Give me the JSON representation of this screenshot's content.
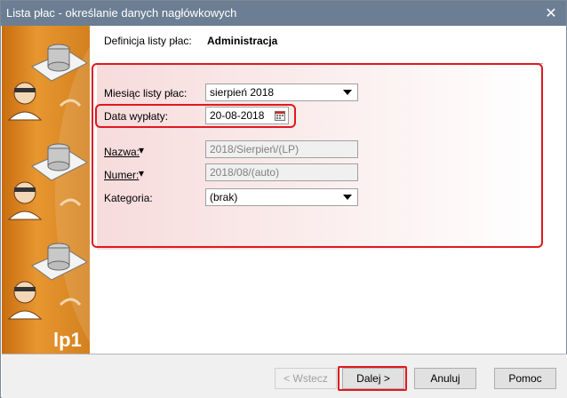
{
  "window": {
    "title": "Lista płac - określanie danych nagłówkowych",
    "close_glyph": "✕"
  },
  "sidebar": {
    "brand": "lp1",
    "icons": [
      "database-person-icon",
      "database-person-icon",
      "database-person-icon"
    ]
  },
  "definition": {
    "label": "Definicja listy płac:",
    "value": "Administracja"
  },
  "form": {
    "month_label": "Miesiąc listy płac:",
    "month_value": "sierpień 2018",
    "paydate_label": "Data wypłaty:",
    "paydate_value": "20-08-2018",
    "name_label": "Nazwa:",
    "name_value": "2018/Sierpień/(LP)",
    "number_label": "Numer:",
    "number_value": "2018/08/(auto)",
    "category_label": "Kategoria:",
    "category_value": "(brak)"
  },
  "buttons": {
    "back": "< Wstecz",
    "next": "Dalej >",
    "cancel": "Anuluj",
    "help": "Pomoc"
  },
  "colors": {
    "accent_red": "#e0181f",
    "sidebar_orange": "#e79630",
    "titlebar": "#6b7e93"
  }
}
